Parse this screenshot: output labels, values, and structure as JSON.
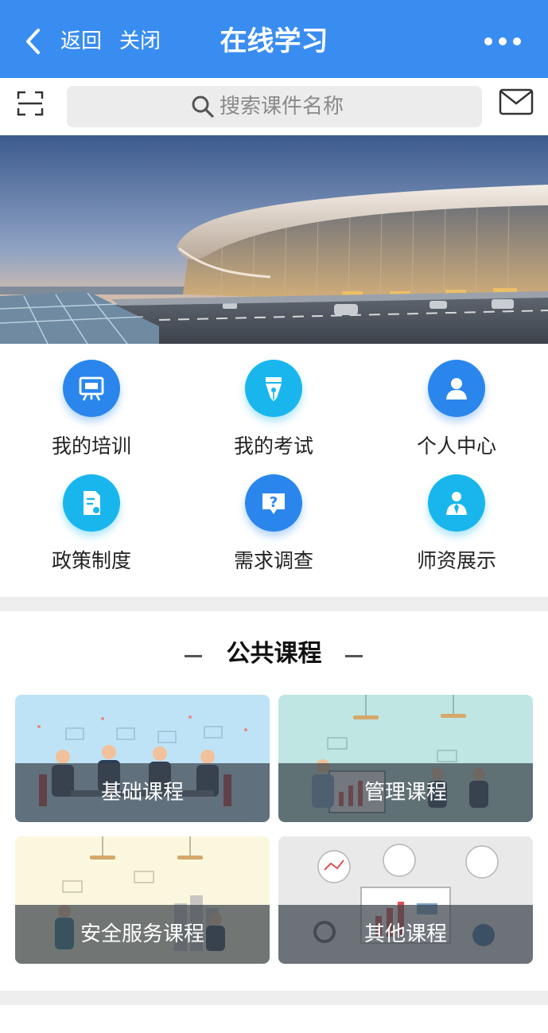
{
  "header": {
    "back_label": "返回",
    "close_label": "关闭",
    "title": "在线学习",
    "bg_color": "#3a8df0"
  },
  "search": {
    "placeholder": "搜索课件名称",
    "value": ""
  },
  "banner": {
    "icon": "airport-terminal-photo"
  },
  "menu": {
    "items": [
      {
        "label": "我的培训",
        "icon": "training-board-icon",
        "color": "#2a86ec"
      },
      {
        "label": "我的考试",
        "icon": "pen-nib-icon",
        "color": "#19b6ee"
      },
      {
        "label": "个人中心",
        "icon": "person-icon",
        "color": "#2a86ec"
      },
      {
        "label": "政策制度",
        "icon": "policy-document-icon",
        "color": "#19b6ee"
      },
      {
        "label": "需求调查",
        "icon": "question-bubble-icon",
        "color": "#2a86ec"
      },
      {
        "label": "师资展示",
        "icon": "teacher-icon",
        "color": "#19b6ee"
      }
    ]
  },
  "public_courses": {
    "title": "公共课程",
    "cards": [
      {
        "label": "基础课程",
        "bg": "#bfe3f6"
      },
      {
        "label": "管理课程",
        "bg": "#bfe6e2"
      },
      {
        "label": "安全服务课程",
        "bg": "#fbf7de"
      },
      {
        "label": "其他课程",
        "bg": "#e9e9e9"
      }
    ]
  }
}
